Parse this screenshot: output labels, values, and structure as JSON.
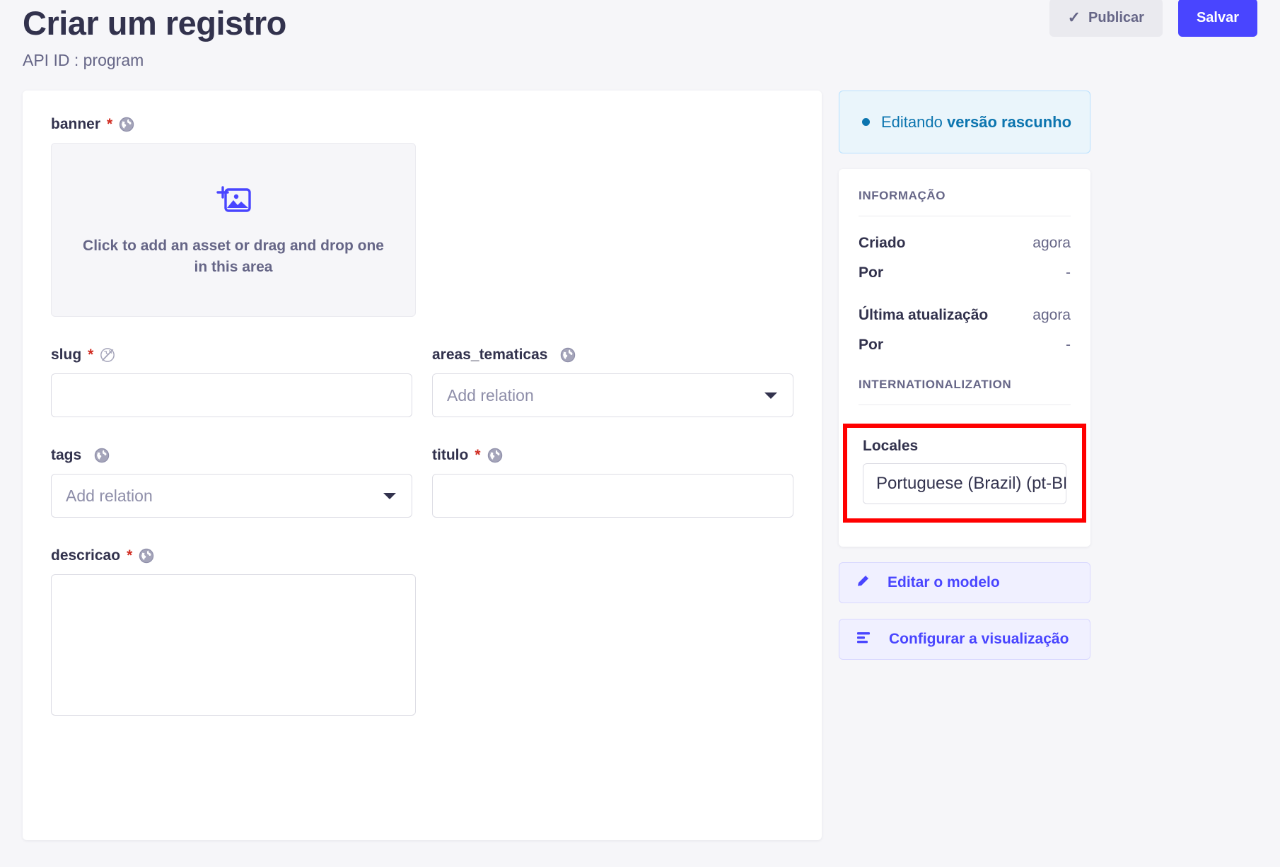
{
  "header": {
    "title": "Criar um registro",
    "api_id": "API ID : program",
    "publish_label": "Publicar",
    "save_label": "Salvar",
    "publish_icon": "check-icon",
    "accent_color": "#4945ff",
    "publish_bg": "#eaeaef"
  },
  "form": {
    "banner": {
      "label": "banner",
      "required_mark": "*",
      "localized_icon": "globe-icon",
      "dropzone_text": "Click to add an asset or drag and drop one in this area",
      "dropzone_icon": "add-image-icon"
    },
    "slug": {
      "label": "slug",
      "required_mark": "*",
      "localized_icon": "globe-crossed-icon",
      "value": "",
      "placeholder": ""
    },
    "areas_tematicas": {
      "label": "areas_tematicas",
      "required_mark": "",
      "localized_icon": "globe-icon",
      "placeholder": "Add relation",
      "caret_icon": "chevron-down-icon"
    },
    "tags": {
      "label": "tags",
      "required_mark": "",
      "localized_icon": "globe-icon",
      "placeholder": "Add relation",
      "caret_icon": "chevron-down-icon"
    },
    "titulo": {
      "label": "titulo",
      "required_mark": "*",
      "localized_icon": "globe-icon",
      "value": "",
      "placeholder": ""
    },
    "descricao": {
      "label": "descricao",
      "required_mark": "*",
      "localized_icon": "globe-icon",
      "value": "",
      "placeholder": ""
    }
  },
  "sidebar": {
    "status": {
      "prefix": "Editando ",
      "strong": "versão rascunho",
      "dot_color": "#0c75af",
      "bg_color": "#eaf5fb"
    },
    "information": {
      "section_title": "INFORMAÇÃO",
      "rows": [
        {
          "key": "Criado",
          "value": "agora"
        },
        {
          "key": "Por",
          "value": "-"
        },
        {
          "key": "Última atualização",
          "value": "agora"
        },
        {
          "key": "Por",
          "value": "-"
        }
      ]
    },
    "internationalization": {
      "section_title": "INTERNATIONALIZATION",
      "locales_label": "Locales",
      "locale_value": "Portuguese (Brazil) (pt-BR)",
      "highlight_color": "#ff0000"
    },
    "actions": [
      {
        "label": "Editar o modelo",
        "icon": "pencil-icon"
      },
      {
        "label": "Configurar a visualização",
        "icon": "layout-list-icon"
      }
    ]
  }
}
